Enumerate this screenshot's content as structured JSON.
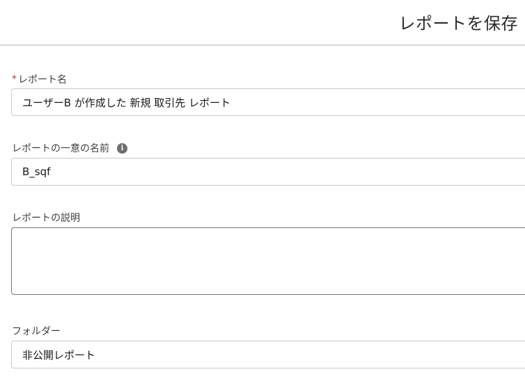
{
  "modal": {
    "title": "レポートを保存"
  },
  "form": {
    "report_name": {
      "required_marker": "*",
      "label": "レポート名",
      "value": "ユーザーB が作成した 新規 取引先 レポート"
    },
    "unique_name": {
      "label": "レポートの一意の名前",
      "info_icon": "info-icon",
      "value": "B_sqf"
    },
    "description": {
      "label": "レポートの説明",
      "value": ""
    },
    "folder": {
      "label": "フォルダー",
      "value": "非公開レポート"
    }
  }
}
